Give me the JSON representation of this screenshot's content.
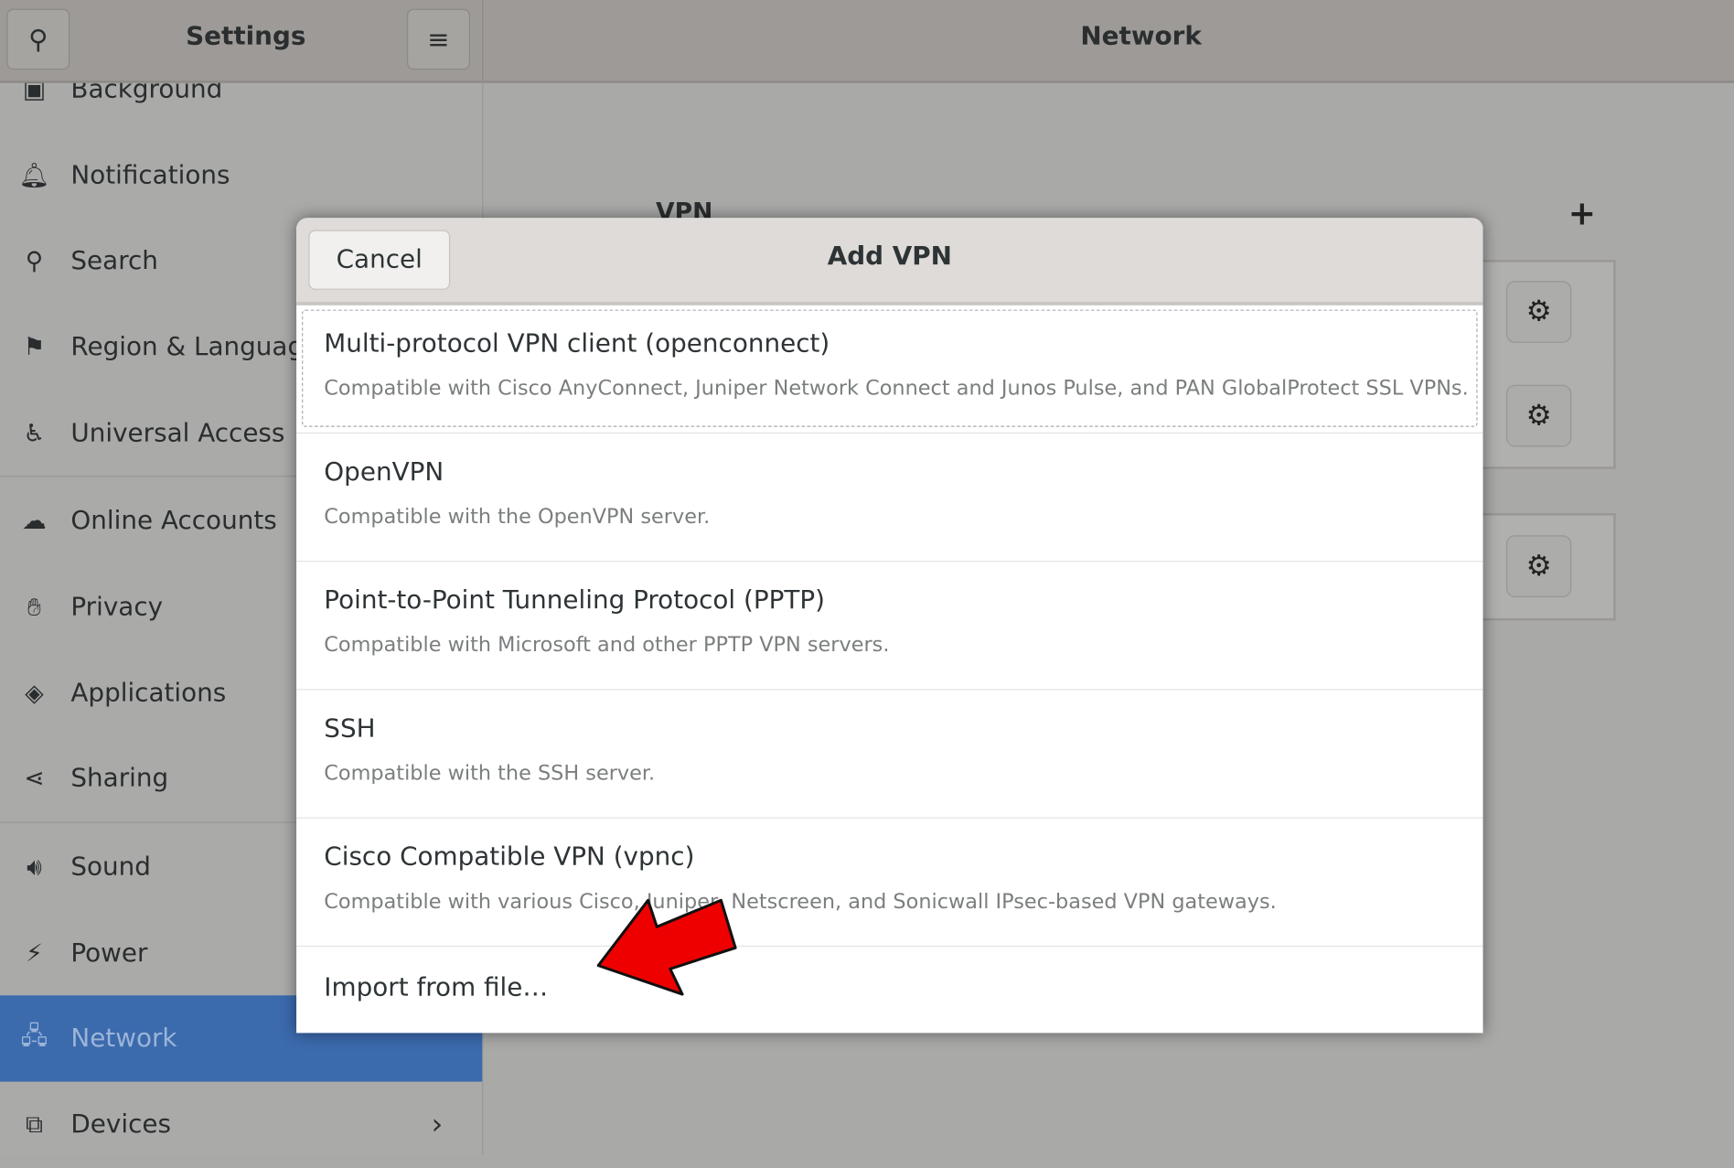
{
  "header": {
    "left_title": "Settings",
    "right_title": "Network",
    "search_icon": "search-icon",
    "menu_icon": "hamburger-menu-icon"
  },
  "sidebar": {
    "items": [
      {
        "label": "Background",
        "icon": "background-icon"
      },
      {
        "label": "Notifications",
        "icon": "bell-icon"
      },
      {
        "label": "Search",
        "icon": "search-icon"
      },
      {
        "label": "Region & Language",
        "icon": "flag-icon"
      },
      {
        "label": "Universal Access",
        "icon": "accessibility-icon"
      },
      {
        "label": "Online Accounts",
        "icon": "cloud-icon"
      },
      {
        "label": "Privacy",
        "icon": "hand-icon"
      },
      {
        "label": "Applications",
        "icon": "applications-icon"
      },
      {
        "label": "Sharing",
        "icon": "share-icon"
      },
      {
        "label": "Sound",
        "icon": "speaker-icon"
      },
      {
        "label": "Power",
        "icon": "power-icon"
      },
      {
        "label": "Network",
        "icon": "network-icon",
        "selected": true
      },
      {
        "label": "Devices",
        "icon": "devices-icon",
        "chevron": true
      }
    ]
  },
  "main": {
    "section_label": "VPN",
    "add_icon": "plus-icon"
  },
  "dialog": {
    "title": "Add VPN",
    "cancel_label": "Cancel",
    "options": [
      {
        "title": "Multi-protocol VPN client (openconnect)",
        "desc": "Compatible with Cisco AnyConnect, Juniper Network Connect and Junos Pulse, and PAN GlobalProtect SSL VPNs."
      },
      {
        "title": "OpenVPN",
        "desc": "Compatible with the OpenVPN server."
      },
      {
        "title": "Point-to-Point Tunneling Protocol (PPTP)",
        "desc": "Compatible with Microsoft and other PPTP VPN servers."
      },
      {
        "title": "SSH",
        "desc": "Compatible with the SSH server."
      },
      {
        "title": "Cisco Compatible VPN (vpnc)",
        "desc": "Compatible with various Cisco, Juniper, Netscreen, and Sonicwall IPsec-based VPN gateways."
      }
    ],
    "import_label": "Import from file…"
  },
  "colors": {
    "selected": "#3b6aad",
    "arrow": "#ee0000"
  }
}
